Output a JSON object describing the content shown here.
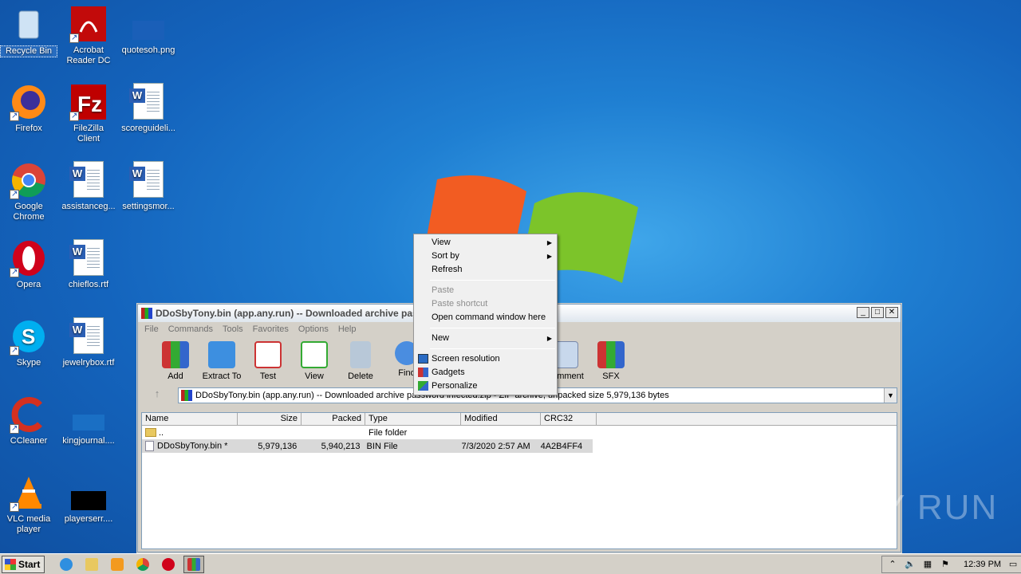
{
  "desktop": {
    "icons": [
      {
        "label": "Recycle Bin"
      },
      {
        "label": "Acrobat Reader DC"
      },
      {
        "label": "quotesoh.png"
      },
      {
        "label": "Firefox"
      },
      {
        "label": "FileZilla Client"
      },
      {
        "label": "scoreguideli..."
      },
      {
        "label": "Google Chrome"
      },
      {
        "label": "assistanceg..."
      },
      {
        "label": "settingsmor..."
      },
      {
        "label": "Opera"
      },
      {
        "label": "chieflos.rtf"
      },
      {
        "label": "Skype"
      },
      {
        "label": "jewelrybox.rtf"
      },
      {
        "label": "CCleaner"
      },
      {
        "label": "kingjournal...."
      },
      {
        "label": "VLC media player"
      },
      {
        "label": "playerserr...."
      }
    ]
  },
  "window": {
    "title": "DDoSbyTony.bin (app.any.run) -- Downloaded archive pass",
    "menu": [
      "File",
      "Commands",
      "Tools",
      "Favorites",
      "Options",
      "Help"
    ],
    "toolbar": [
      "Add",
      "Extract To",
      "Test",
      "View",
      "Delete",
      "Find",
      "Comment",
      "SFX"
    ],
    "address": "DDoSbyTony.bin (app.any.run) -- Downloaded archive password infected.zip - ZIP archive, unpacked size 5,979,136 bytes",
    "columns": [
      "Name",
      "Size",
      "Packed",
      "Type",
      "Modified",
      "CRC32"
    ],
    "rows": [
      {
        "name": "..",
        "size": "",
        "packed": "",
        "type": "File folder",
        "modified": "",
        "crc": ""
      },
      {
        "name": "DDoSbyTony.bin *",
        "size": "5,979,136",
        "packed": "5,940,213",
        "type": "BIN File",
        "modified": "7/3/2020 2:57 AM",
        "crc": "4A2B4FF4"
      }
    ]
  },
  "context_menu": {
    "items": [
      "View",
      "Sort by",
      "Refresh",
      "Paste",
      "Paste shortcut",
      "Open command window here",
      "New",
      "Screen resolution",
      "Gadgets",
      "Personalize"
    ]
  },
  "taskbar": {
    "start_label": "Start",
    "clock": "12:39 PM"
  },
  "watermark": "ANY RUN"
}
